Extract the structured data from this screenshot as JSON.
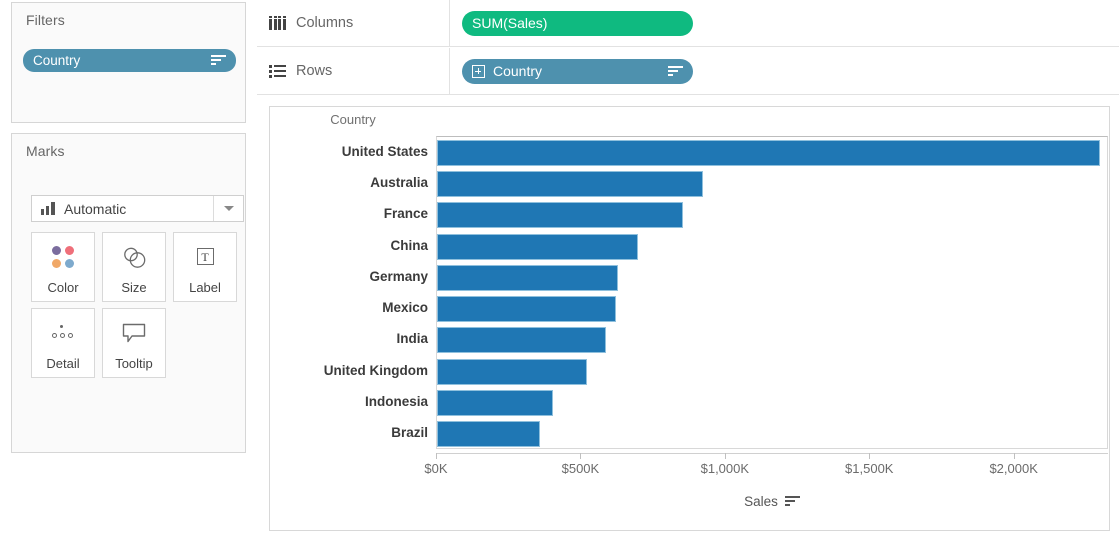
{
  "filters": {
    "title": "Filters",
    "pills": [
      {
        "label": "Country",
        "icon": "sort-descending-icon",
        "color": "#4e91ae"
      }
    ]
  },
  "marks": {
    "title": "Marks",
    "type_selector": {
      "value": "Automatic",
      "icon": "bar-mark-icon",
      "caret": "chevron-down-icon"
    },
    "buttons": [
      {
        "label": "Color",
        "icon": "color-dots-icon"
      },
      {
        "label": "Size",
        "icon": "size-circles-icon"
      },
      {
        "label": "Label",
        "icon": "text-label-icon",
        "glyph": "T"
      },
      {
        "label": "Detail",
        "icon": "detail-dots-icon"
      },
      {
        "label": "Tooltip",
        "icon": "tooltip-bubble-icon"
      }
    ]
  },
  "shelves": [
    {
      "name": "Columns",
      "icon": "columns-icon",
      "pill": {
        "label": "SUM(Sales)",
        "color": "#0fba80",
        "type": "measure"
      }
    },
    {
      "name": "Rows",
      "icon": "rows-icon",
      "pill": {
        "label": "Country",
        "color": "#4e91ae",
        "type": "dimension",
        "expand_icon": "plus-box-icon",
        "sort_icon": "sort-descending-icon"
      }
    }
  ],
  "view": {
    "row_header_title": "Country",
    "axis_title": "Sales",
    "axis_title_sort_icon": "sort-descending-icon"
  },
  "chart_data": {
    "type": "bar",
    "orientation": "horizontal",
    "title": "",
    "xlabel": "Sales",
    "ylabel": "Country",
    "categories": [
      "United States",
      "Australia",
      "France",
      "China",
      "Germany",
      "Mexico",
      "India",
      "United Kingdom",
      "Indonesia",
      "Brazil"
    ],
    "values": [
      2296000,
      921000,
      853000,
      696000,
      625000,
      618000,
      586000,
      521000,
      400000,
      357000
    ],
    "value_unit": "USD",
    "xlim": [
      0,
      2330000
    ],
    "xticks": [
      0,
      500000,
      1000000,
      1500000,
      2000000
    ],
    "xtick_labels": [
      "$0K",
      "$500K",
      "$1,000K",
      "$1,500K",
      "$2,000K"
    ],
    "bar_color": "#1f77b4",
    "grid": false,
    "legend": "none",
    "sorted": "descending"
  }
}
